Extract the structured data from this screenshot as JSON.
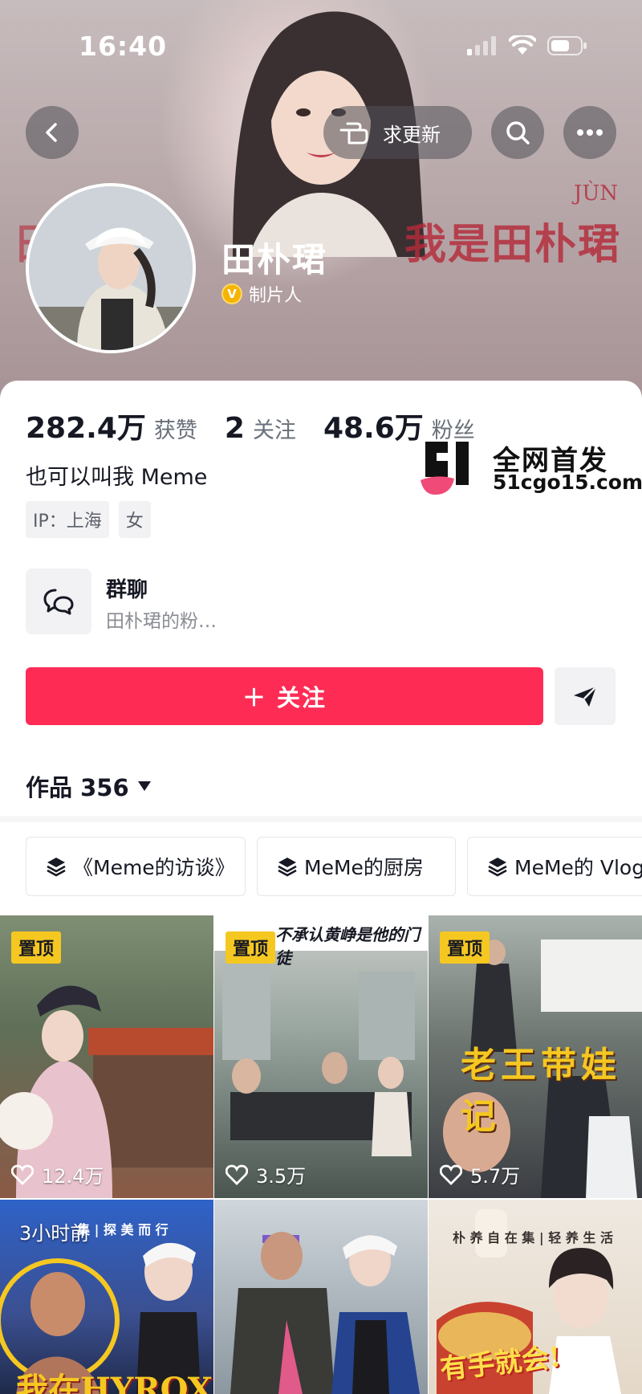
{
  "status_bar": {
    "time": "16:40"
  },
  "header": {
    "request_update_label": "求更新",
    "cover_sign_text": "我是田朴珺",
    "cover_pinyin": "JÙN",
    "cover_sign_partial": "田    是"
  },
  "profile": {
    "name": "田朴珺",
    "verification": "制片人",
    "verify_badge": "V",
    "stats": [
      {
        "value": "282.4万",
        "label": "获赞"
      },
      {
        "value": "2",
        "label": "关注"
      },
      {
        "value": "48.6万",
        "label": "粉丝"
      }
    ],
    "bio": "也可以叫我 Meme",
    "tags": [
      "IP：上海",
      "女"
    ]
  },
  "watermark": {
    "title": "全网首发",
    "url": "51cgo15.com"
  },
  "group_chat": {
    "title": "群聊",
    "subtitle": "田朴珺的粉…"
  },
  "actions": {
    "follow_label": "＋ 关注"
  },
  "works": {
    "label": "作品 356"
  },
  "collections": [
    "《Meme的访谈》",
    "MeMe的厨房",
    "MeMe的 Vlog"
  ],
  "videos": [
    {
      "pinned": "置顶",
      "likes": "12.4万",
      "caption": ""
    },
    {
      "pinned": "置顶",
      "likes": "3.5万",
      "caption": "不承认黄峥是他的门徒"
    },
    {
      "pinned": "置顶",
      "likes": "5.7万",
      "caption": "老王带娃记"
    },
    {
      "time": "3小时前",
      "caption": "我在HYROX",
      "subcaption": "集 | 探 美 而 行"
    },
    {
      "caption": ""
    },
    {
      "caption": "有手就会!",
      "subcaption": "朴 养 自 在 集 | 轻 养 生 活"
    }
  ]
}
